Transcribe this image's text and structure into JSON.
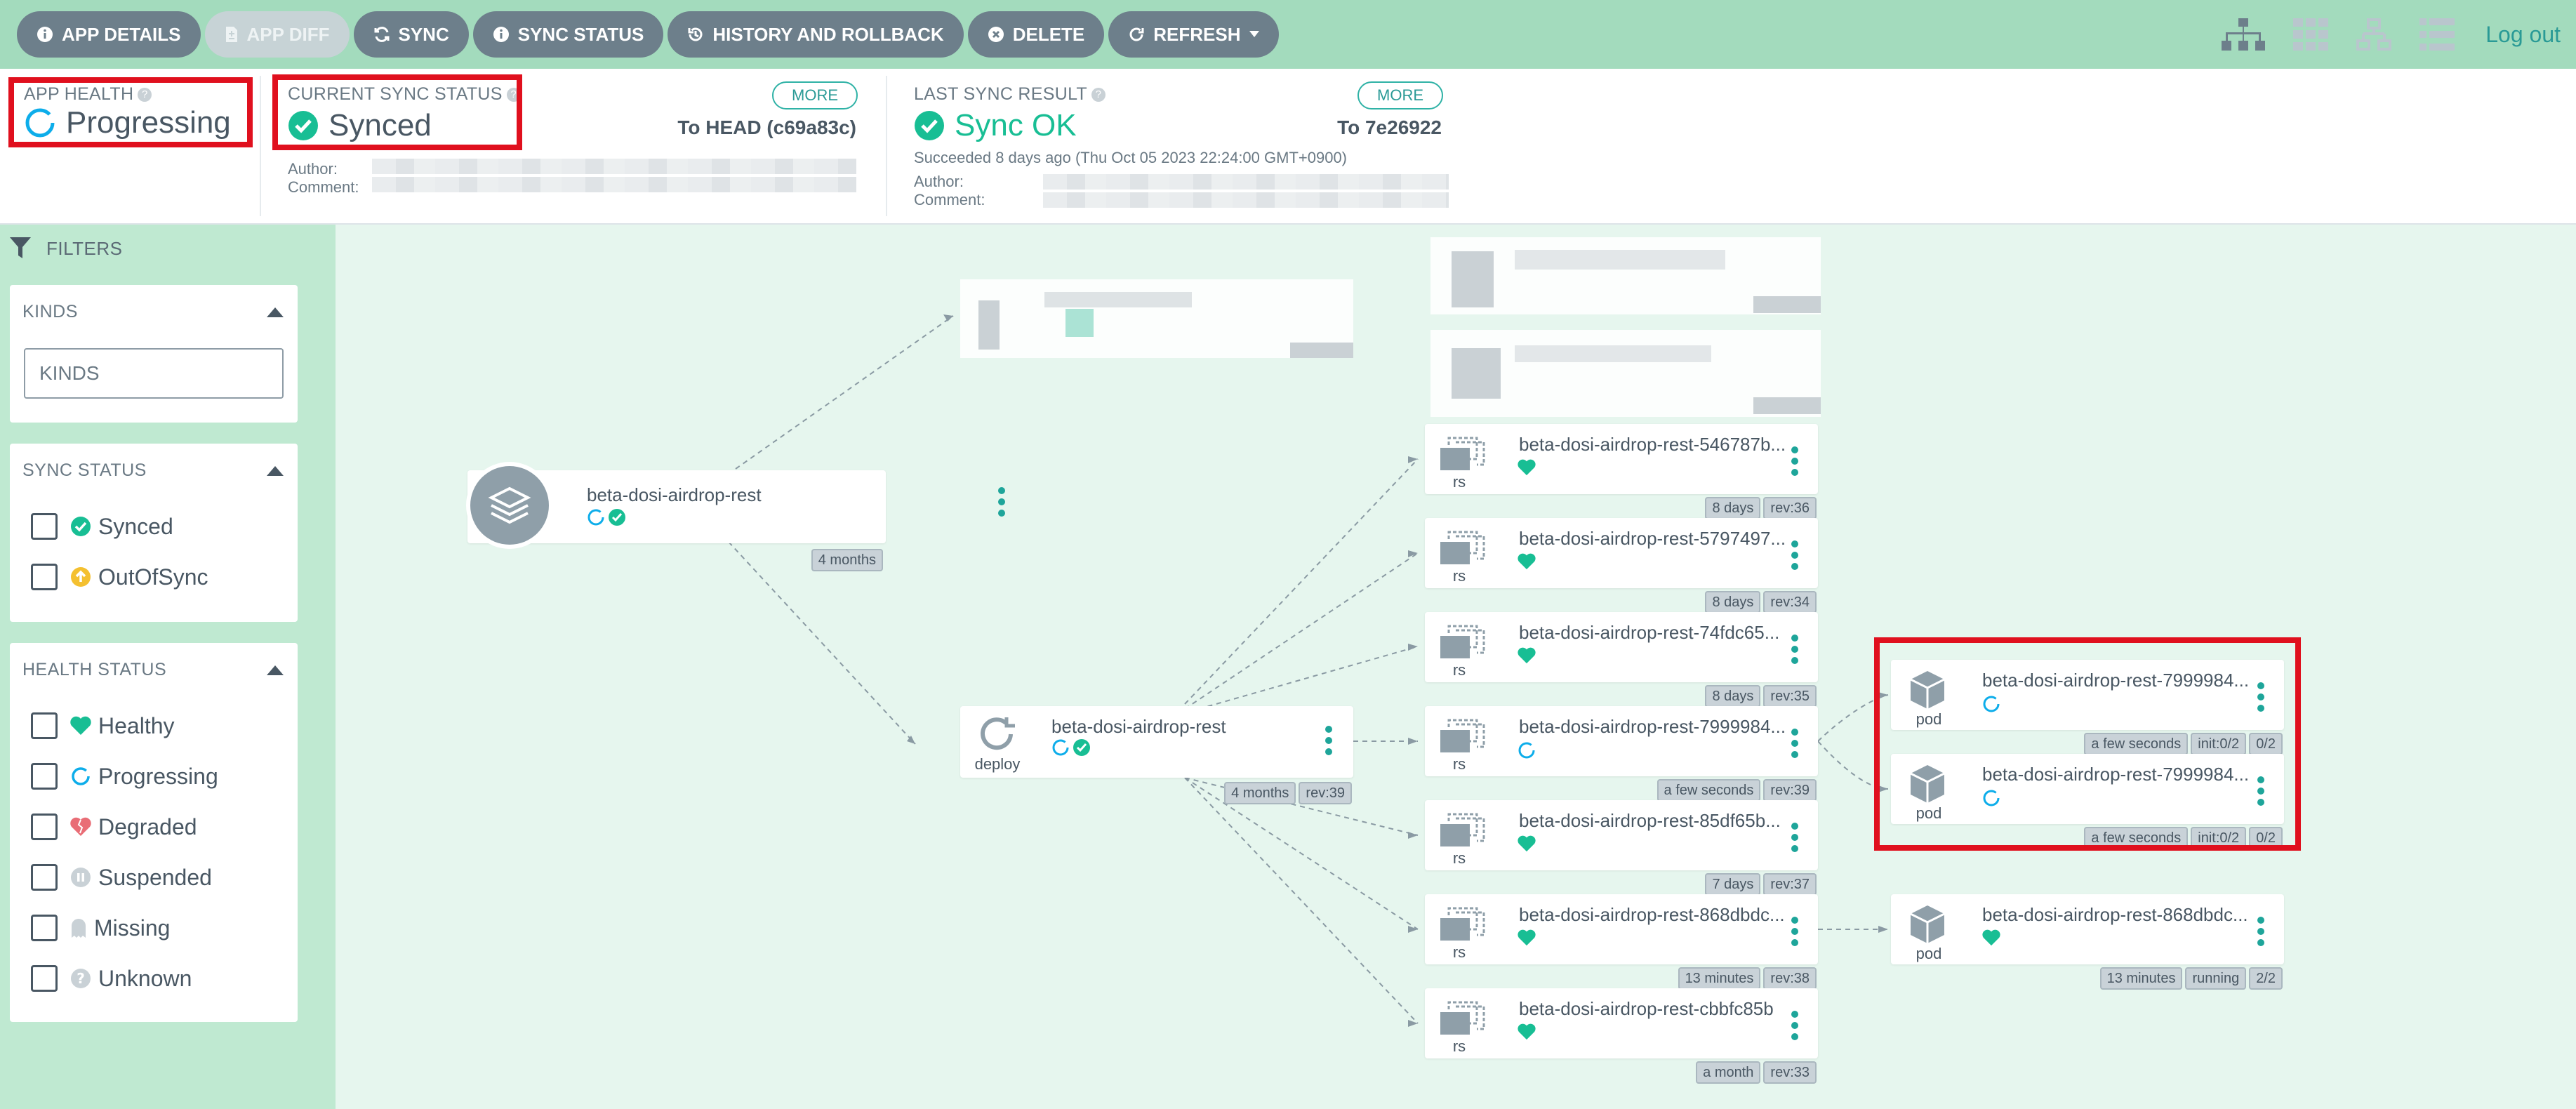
{
  "toolbar": {
    "buttons": [
      {
        "label": "APP DETAILS",
        "icon": "info-circle-icon"
      },
      {
        "label": "APP DIFF",
        "icon": "file-diff-icon"
      },
      {
        "label": "SYNC",
        "icon": "sync-icon"
      },
      {
        "label": "SYNC STATUS",
        "icon": "info-circle-icon"
      },
      {
        "label": "HISTORY AND ROLLBACK",
        "icon": "history-icon"
      },
      {
        "label": "DELETE",
        "icon": "times-circle-icon"
      },
      {
        "label": "REFRESH",
        "icon": "redo-icon"
      }
    ],
    "logout_label": "Log out",
    "view_icons": [
      "tree-view-icon",
      "pods-view-icon",
      "network-view-icon",
      "list-view-icon"
    ]
  },
  "status": {
    "app_health": {
      "title": "APP HEALTH",
      "value": "Progressing"
    },
    "current_sync": {
      "title": "CURRENT SYNC STATUS",
      "value": "Synced",
      "more_label": "MORE",
      "target": "To HEAD (c69a83c)",
      "author_label": "Author:",
      "comment_label": "Comment:"
    },
    "last_sync": {
      "title": "LAST SYNC RESULT",
      "value": "Sync OK",
      "more_label": "MORE",
      "target": "To 7e26922",
      "detail": "Succeeded 8 days ago (Thu Oct 05 2023 22:24:00 GMT+0900)",
      "author_label": "Author:",
      "comment_label": "Comment:"
    }
  },
  "filters": {
    "header": "FILTERS",
    "kinds": {
      "title": "KINDS",
      "placeholder": "KINDS"
    },
    "sync_status": {
      "title": "SYNC STATUS",
      "items": [
        "Synced",
        "OutOfSync"
      ]
    },
    "health_status": {
      "title": "HEALTH STATUS",
      "items": [
        "Healthy",
        "Progressing",
        "Degraded",
        "Suspended",
        "Missing",
        "Unknown"
      ]
    }
  },
  "graph": {
    "app": {
      "name": "beta-dosi-airdrop-rest",
      "tags": [
        "4 months"
      ]
    },
    "deploy": {
      "name": "beta-dosi-airdrop-rest",
      "kind": "deploy",
      "tags": [
        "4 months",
        "rev:39"
      ]
    },
    "replicasets": [
      {
        "name": "beta-dosi-airdrop-rest-546787b...",
        "kind": "rs",
        "health": "healthy",
        "tags": [
          "8 days",
          "rev:36"
        ]
      },
      {
        "name": "beta-dosi-airdrop-rest-5797497...",
        "kind": "rs",
        "health": "healthy",
        "tags": [
          "8 days",
          "rev:34"
        ]
      },
      {
        "name": "beta-dosi-airdrop-rest-74fdc65...",
        "kind": "rs",
        "health": "healthy",
        "tags": [
          "8 days",
          "rev:35"
        ]
      },
      {
        "name": "beta-dosi-airdrop-rest-7999984...",
        "kind": "rs",
        "health": "progressing",
        "tags": [
          "a few seconds",
          "rev:39"
        ]
      },
      {
        "name": "beta-dosi-airdrop-rest-85df65b...",
        "kind": "rs",
        "health": "healthy",
        "tags": [
          "7 days",
          "rev:37"
        ]
      },
      {
        "name": "beta-dosi-airdrop-rest-868dbdc...",
        "kind": "rs",
        "health": "healthy",
        "tags": [
          "13 minutes",
          "rev:38"
        ]
      },
      {
        "name": "beta-dosi-airdrop-rest-cbbfc85b",
        "kind": "rs",
        "health": "healthy",
        "tags": [
          "a month",
          "rev:33"
        ]
      }
    ],
    "pods": [
      {
        "name": "beta-dosi-airdrop-rest-7999984...",
        "kind": "pod",
        "health": "progressing",
        "tags": [
          "a few seconds",
          "init:0/2",
          "0/2"
        ]
      },
      {
        "name": "beta-dosi-airdrop-rest-7999984...",
        "kind": "pod",
        "health": "progressing",
        "tags": [
          "a few seconds",
          "init:0/2",
          "0/2"
        ]
      },
      {
        "name": "beta-dosi-airdrop-rest-868dbdc...",
        "kind": "pod",
        "health": "healthy",
        "tags": [
          "13 minutes",
          "running",
          "2/2"
        ]
      }
    ]
  },
  "colors": {
    "toolbar_bg": "#a3dbbd",
    "button_bg": "#6d7f8b",
    "synced_green": "#18be94",
    "progressing_blue": "#0dadea",
    "degraded_red": "#e96d76",
    "highlight_red": "#e0101e",
    "canvas_bg": "#e6f6ee",
    "sidebar_bg": "#bfe9d1"
  }
}
